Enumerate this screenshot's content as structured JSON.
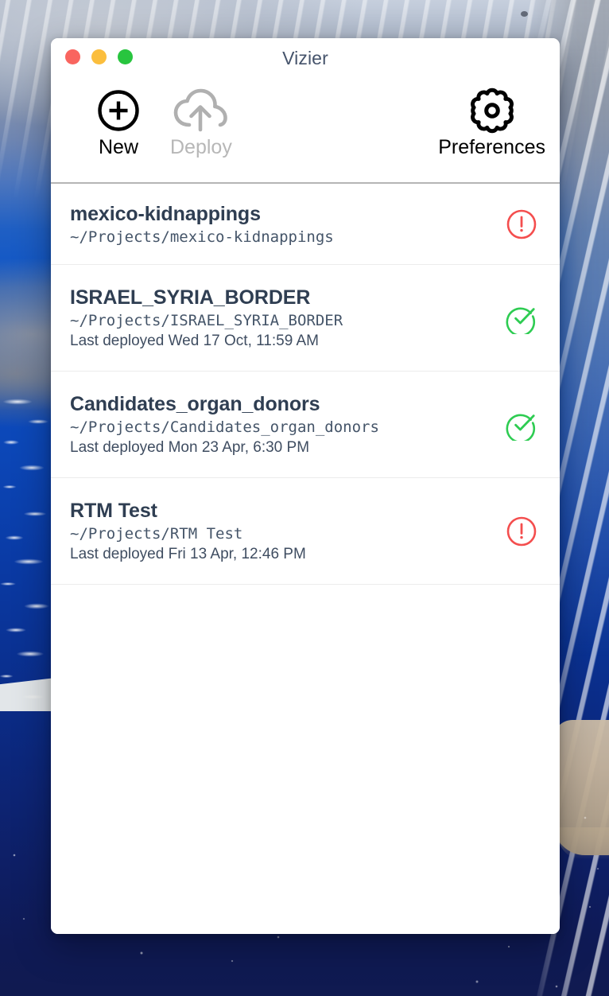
{
  "window": {
    "title": "Vizier",
    "traffic_lights": [
      {
        "name": "close",
        "color": "#f9655f"
      },
      {
        "name": "minimize",
        "color": "#fbbe3d"
      },
      {
        "name": "maximize",
        "color": "#28c53f"
      }
    ]
  },
  "toolbar": {
    "buttons": [
      {
        "label": "New",
        "icon": "plus-circle-icon",
        "enabled": true
      },
      {
        "label": "Deploy",
        "icon": "cloud-upload-icon",
        "enabled": false
      },
      {
        "label": "Preferences",
        "icon": "gear-icon",
        "enabled": true
      }
    ]
  },
  "colors": {
    "status_error": "#f44e4e",
    "status_success": "#2ecc52",
    "title_text": "#45536b",
    "project_name": "#2f3e52",
    "disabled": "#b7b7b7",
    "toolbar_divider": "#b5b5b5",
    "row_divider": "#ececec"
  },
  "projects": [
    {
      "name": "mexico-kidnappings",
      "path": "~/Projects/mexico-kidnappings",
      "deployed": "",
      "status": "error",
      "status_icon": "error-circle-icon"
    },
    {
      "name": "ISRAEL_SYRIA_BORDER",
      "path": "~/Projects/ISRAEL_SYRIA_BORDER",
      "deployed": "Last deployed Wed 17 Oct, 11:59 AM",
      "status": "success",
      "status_icon": "check-circle-icon"
    },
    {
      "name": "Candidates_organ_donors",
      "path": "~/Projects/Candidates_organ_donors",
      "deployed": "Last deployed Mon 23 Apr, 6:30 PM",
      "status": "success",
      "status_icon": "check-circle-icon"
    },
    {
      "name": "RTM Test",
      "path": "~/Projects/RTM Test",
      "deployed": "Last deployed Fri 13 Apr, 12:46 PM",
      "status": "error",
      "status_icon": "error-circle-icon"
    }
  ]
}
